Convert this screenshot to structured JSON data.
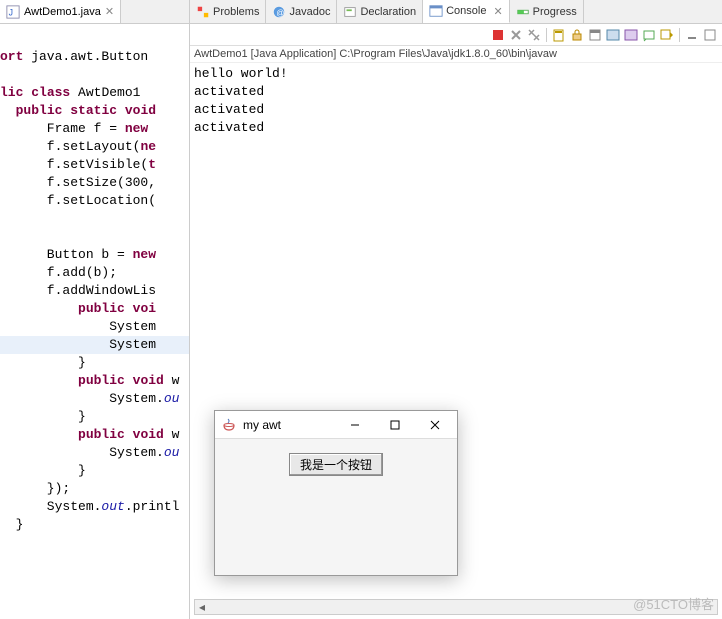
{
  "editor": {
    "tab": {
      "filename": "AwtDemo1.java"
    },
    "lines": [
      "",
      "ort java.awt.Button",
      "",
      "lic class AwtDemo1",
      "  public static void",
      "      Frame f = new ",
      "      f.setLayout(ne",
      "      f.setVisible(t",
      "      f.setSize(300,",
      "      f.setLocation(",
      "",
      "",
      "      Button b = new",
      "      f.add(b);",
      "      f.addWindowLis",
      "          public voi",
      "              System",
      "              System",
      "          }",
      "          public void w",
      "              System.ou",
      "          }",
      "          public void w",
      "              System.ou",
      "          }",
      "      });",
      "      System.out.printl",
      "  }"
    ]
  },
  "views": {
    "tabs": [
      {
        "label": "Problems"
      },
      {
        "label": "Javadoc"
      },
      {
        "label": "Declaration"
      },
      {
        "label": "Console",
        "active": true
      },
      {
        "label": "Progress"
      }
    ]
  },
  "toolbar": {
    "buttons": [
      "terminate",
      "remove-launch",
      "remove-all",
      "clear",
      "scroll-lock",
      "word-wrap",
      "show-console",
      "pin",
      "display-selected",
      "open-console",
      "minimize",
      "maximize"
    ]
  },
  "console": {
    "header": "AwtDemo1 [Java Application] C:\\Program Files\\Java\\jdk1.8.0_60\\bin\\javaw",
    "output": "hello world!\nactivated\nactivated\nactivated"
  },
  "awt_window": {
    "title": "my awt",
    "button_label": "我是一个按钮"
  },
  "watermark": "@51CTO博客"
}
